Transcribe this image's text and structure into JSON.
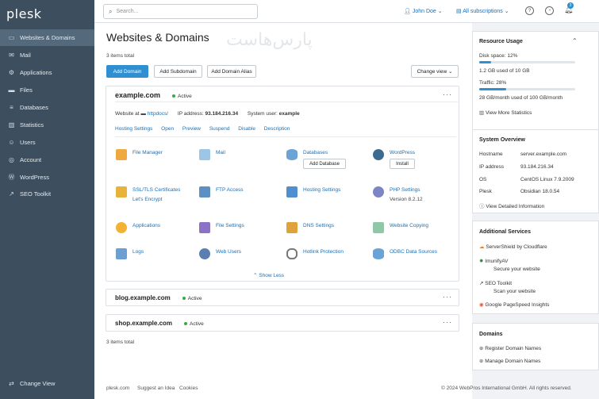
{
  "sidebar": {
    "logo": "plesk",
    "items": [
      {
        "label": "Websites & Domains",
        "icon": "monitor-icon"
      },
      {
        "label": "Mail",
        "icon": "envelope-icon"
      },
      {
        "label": "Applications",
        "icon": "gear-icon"
      },
      {
        "label": "Files",
        "icon": "folder-icon"
      },
      {
        "label": "Databases",
        "icon": "database-icon"
      },
      {
        "label": "Statistics",
        "icon": "bar-chart-icon"
      },
      {
        "label": "Users",
        "icon": "user-icon"
      },
      {
        "label": "Account",
        "icon": "account-icon"
      },
      {
        "label": "WordPress",
        "icon": "wordpress-icon"
      },
      {
        "label": "SEO Toolkit",
        "icon": "seo-chart-icon"
      }
    ],
    "change_view": "Change View"
  },
  "topbar": {
    "search_placeholder": "Search...",
    "user": "John Doe",
    "subscriptions": "All subscriptions",
    "notifications_count": "3"
  },
  "watermark": "پارس‌هاست",
  "main": {
    "title": "Websites & Domains",
    "items_total_top": "3 items total",
    "items_total_bottom": "3 items total",
    "buttons": {
      "add_domain": "Add Domain",
      "add_subdomain": "Add Subdomain",
      "add_alias": "Add Domain Alias",
      "change_view": "Change view"
    },
    "domain_main": {
      "name": "example.com",
      "status": "Active",
      "website_at_label": "Website at",
      "website_at_value": "httpdocs/",
      "ip_label": "IP address:",
      "ip_value": "93.184.216.34",
      "sysuser_label": "System user:",
      "sysuser_value": "example",
      "links": [
        "Hosting Settings",
        "Open",
        "Preview",
        "Suspend",
        "Disable",
        "Description"
      ],
      "show_less": "Show Less"
    },
    "tools": {
      "file_manager": "File Manager",
      "mail": "Mail",
      "databases": "Databases",
      "add_database": "Add Database",
      "wordpress": "WordPress",
      "install": "Install",
      "ssl": "SSL/TLS Certificates",
      "lets_encrypt": "Let's Encrypt",
      "ftp": "FTP Access",
      "hosting_settings": "Hosting Settings",
      "php_settings": "PHP Settings",
      "php_version": "Version 8.2.12",
      "applications": "Applications",
      "file_settings": "File Settings",
      "dns_settings": "DNS Settings",
      "website_copying": "Website Copying",
      "logs": "Logs",
      "web_users": "Web Users",
      "hotlink": "Hotlink Protection",
      "odbc": "ODBC Data Sources"
    },
    "domain_blog": {
      "name": "blog.example.com",
      "status": "Active"
    },
    "domain_shop": {
      "name": "shop.example.com",
      "status": "Active"
    }
  },
  "right": {
    "resource": {
      "title": "Resource Usage",
      "disk_label": "Disk space: 12%",
      "disk_fraction": 0.12,
      "disk_detail": "1.2 GB used of 10 GB",
      "traffic_label": "Traffic: 28%",
      "traffic_fraction": 0.28,
      "traffic_detail": "28 GB/month used of 100 GB/month",
      "more_link": "View More Statistics"
    },
    "system": {
      "title": "System Overview",
      "rows": [
        {
          "k": "Hostname",
          "v": "server.example.com"
        },
        {
          "k": "IP address",
          "v": "93.184.216.34"
        },
        {
          "k": "OS",
          "v": "CentOS Linux 7.9.2009"
        },
        {
          "k": "Plesk",
          "v": "Obsidian 18.0.54"
        }
      ],
      "detail_link": "View Detailed Information"
    },
    "services": {
      "title": "Additional Services",
      "serviceshield": "ServerShield by Cloudflare",
      "imunify": "ImunifyAV",
      "imunify_sub": "Secure your website",
      "seo": "SEO Toolkit",
      "seo_sub": "Scan your website",
      "pagespeed": "Google PageSpeed Insights"
    },
    "domains": {
      "title": "Domains",
      "register": "Register Domain Names",
      "manage": "Manage Domain Names"
    }
  },
  "footer": {
    "links": [
      "plesk.com",
      "Suggest an Idea",
      "Cookies"
    ],
    "copyright": "© 2024 WebPros International GmbH. All rights reserved."
  },
  "colors": {
    "sidebar_bg": "#3d4e5e",
    "sidebar_active": "#54697b",
    "primary": "#2f8fd0",
    "link": "#1a6fb5",
    "active_green": "#3aa845"
  }
}
